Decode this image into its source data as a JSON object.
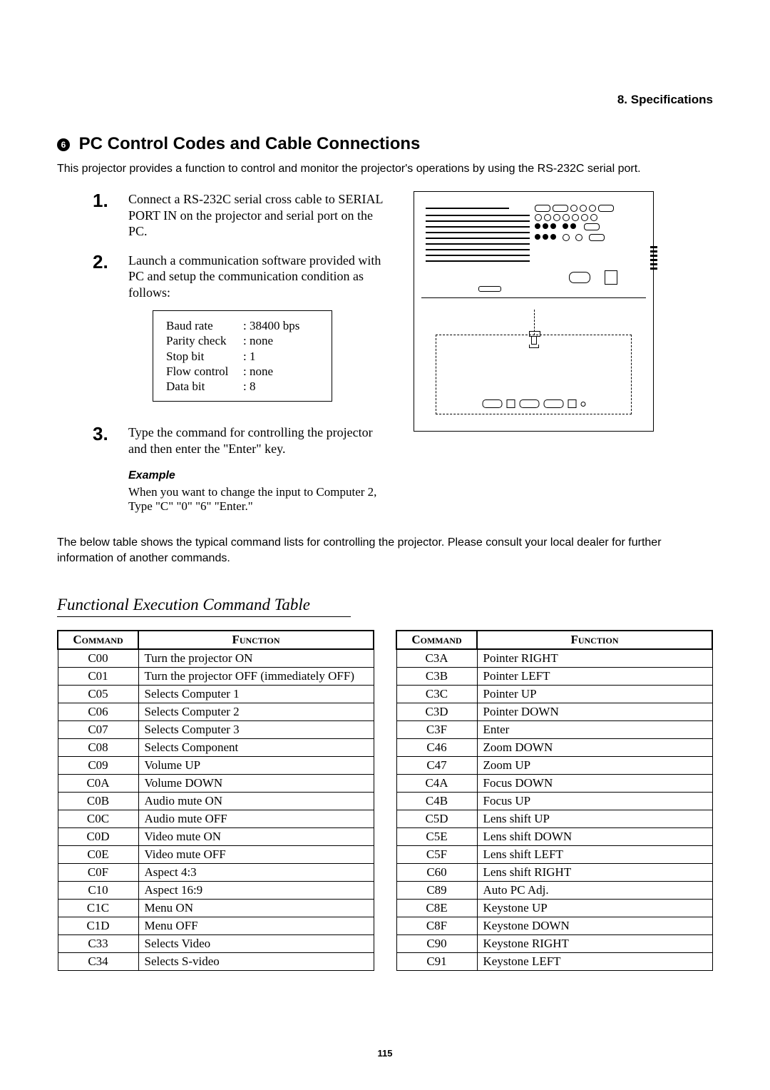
{
  "header": {
    "section_label": "8. Specifications"
  },
  "title": {
    "bullet_glyph": "❻",
    "text": "PC Control Codes and Cable Connections"
  },
  "intro": "This projector provides a function to control and monitor the projector's operations by using the RS-232C serial port.",
  "steps": [
    {
      "num": "1.",
      "text": "Connect a RS-232C serial cross cable to SERIAL PORT IN on the projector and serial port on the PC."
    },
    {
      "num": "2.",
      "text": "Launch a communication software provided with PC and setup the communication condition as follows:"
    },
    {
      "num": "3.",
      "text": "Type the command for controlling the projector and then enter the \"Enter\" key."
    }
  ],
  "params": [
    {
      "k": "Baud rate",
      "v": "38400 bps"
    },
    {
      "k": "Parity check",
      "v": "none"
    },
    {
      "k": "Stop bit",
      "v": "1"
    },
    {
      "k": "Flow control",
      "v": "none"
    },
    {
      "k": "Data bit",
      "v": "8"
    }
  ],
  "example": {
    "label": "Example",
    "text": "When you want to change the input to Computer 2, Type \"C\" \"0\" \"6\" \"Enter.\""
  },
  "table_note": "The below table shows the typical command lists for controlling the projector. Please consult your local dealer for further information of another commands.",
  "fect_title": "Functional Execution Command Table",
  "table_headers": {
    "cmd": "Command",
    "fn": "Function"
  },
  "table_left": [
    {
      "c": "C00",
      "f": "Turn the projector ON"
    },
    {
      "c": "C01",
      "f": "Turn the projector OFF (immediately OFF)"
    },
    {
      "c": "C05",
      "f": "Selects Computer 1"
    },
    {
      "c": "C06",
      "f": "Selects Computer 2"
    },
    {
      "c": "C07",
      "f": "Selects Computer 3"
    },
    {
      "c": "C08",
      "f": "Selects Component"
    },
    {
      "c": "C09",
      "f": "Volume UP"
    },
    {
      "c": "C0A",
      "f": "Volume DOWN"
    },
    {
      "c": "C0B",
      "f": "Audio mute ON"
    },
    {
      "c": "C0C",
      "f": "Audio mute OFF"
    },
    {
      "c": "C0D",
      "f": "Video mute ON"
    },
    {
      "c": "C0E",
      "f": "Video mute OFF"
    },
    {
      "c": "C0F",
      "f": "Aspect 4:3"
    },
    {
      "c": "C10",
      "f": "Aspect 16:9"
    },
    {
      "c": "C1C",
      "f": "Menu ON"
    },
    {
      "c": "C1D",
      "f": "Menu OFF"
    },
    {
      "c": "C33",
      "f": "Selects Video"
    },
    {
      "c": "C34",
      "f": "Selects S-video"
    }
  ],
  "table_right": [
    {
      "c": "C3A",
      "f": "Pointer RIGHT"
    },
    {
      "c": "C3B",
      "f": "Pointer LEFT"
    },
    {
      "c": "C3C",
      "f": "Pointer UP"
    },
    {
      "c": "C3D",
      "f": "Pointer DOWN"
    },
    {
      "c": "C3F",
      "f": "Enter"
    },
    {
      "c": "C46",
      "f": "Zoom DOWN"
    },
    {
      "c": "C47",
      "f": "Zoom UP"
    },
    {
      "c": "C4A",
      "f": "Focus DOWN"
    },
    {
      "c": "C4B",
      "f": "Focus UP"
    },
    {
      "c": "C5D",
      "f": "Lens shift UP"
    },
    {
      "c": "C5E",
      "f": "Lens shift DOWN"
    },
    {
      "c": "C5F",
      "f": "Lens shift LEFT"
    },
    {
      "c": "C60",
      "f": "Lens shift RIGHT"
    },
    {
      "c": "C89",
      "f": "Auto PC Adj."
    },
    {
      "c": "C8E",
      "f": "Keystone UP"
    },
    {
      "c": "C8F",
      "f": "Keystone DOWN"
    },
    {
      "c": "C90",
      "f": "Keystone RIGHT"
    },
    {
      "c": "C91",
      "f": "Keystone LEFT"
    }
  ],
  "page_number": "115"
}
